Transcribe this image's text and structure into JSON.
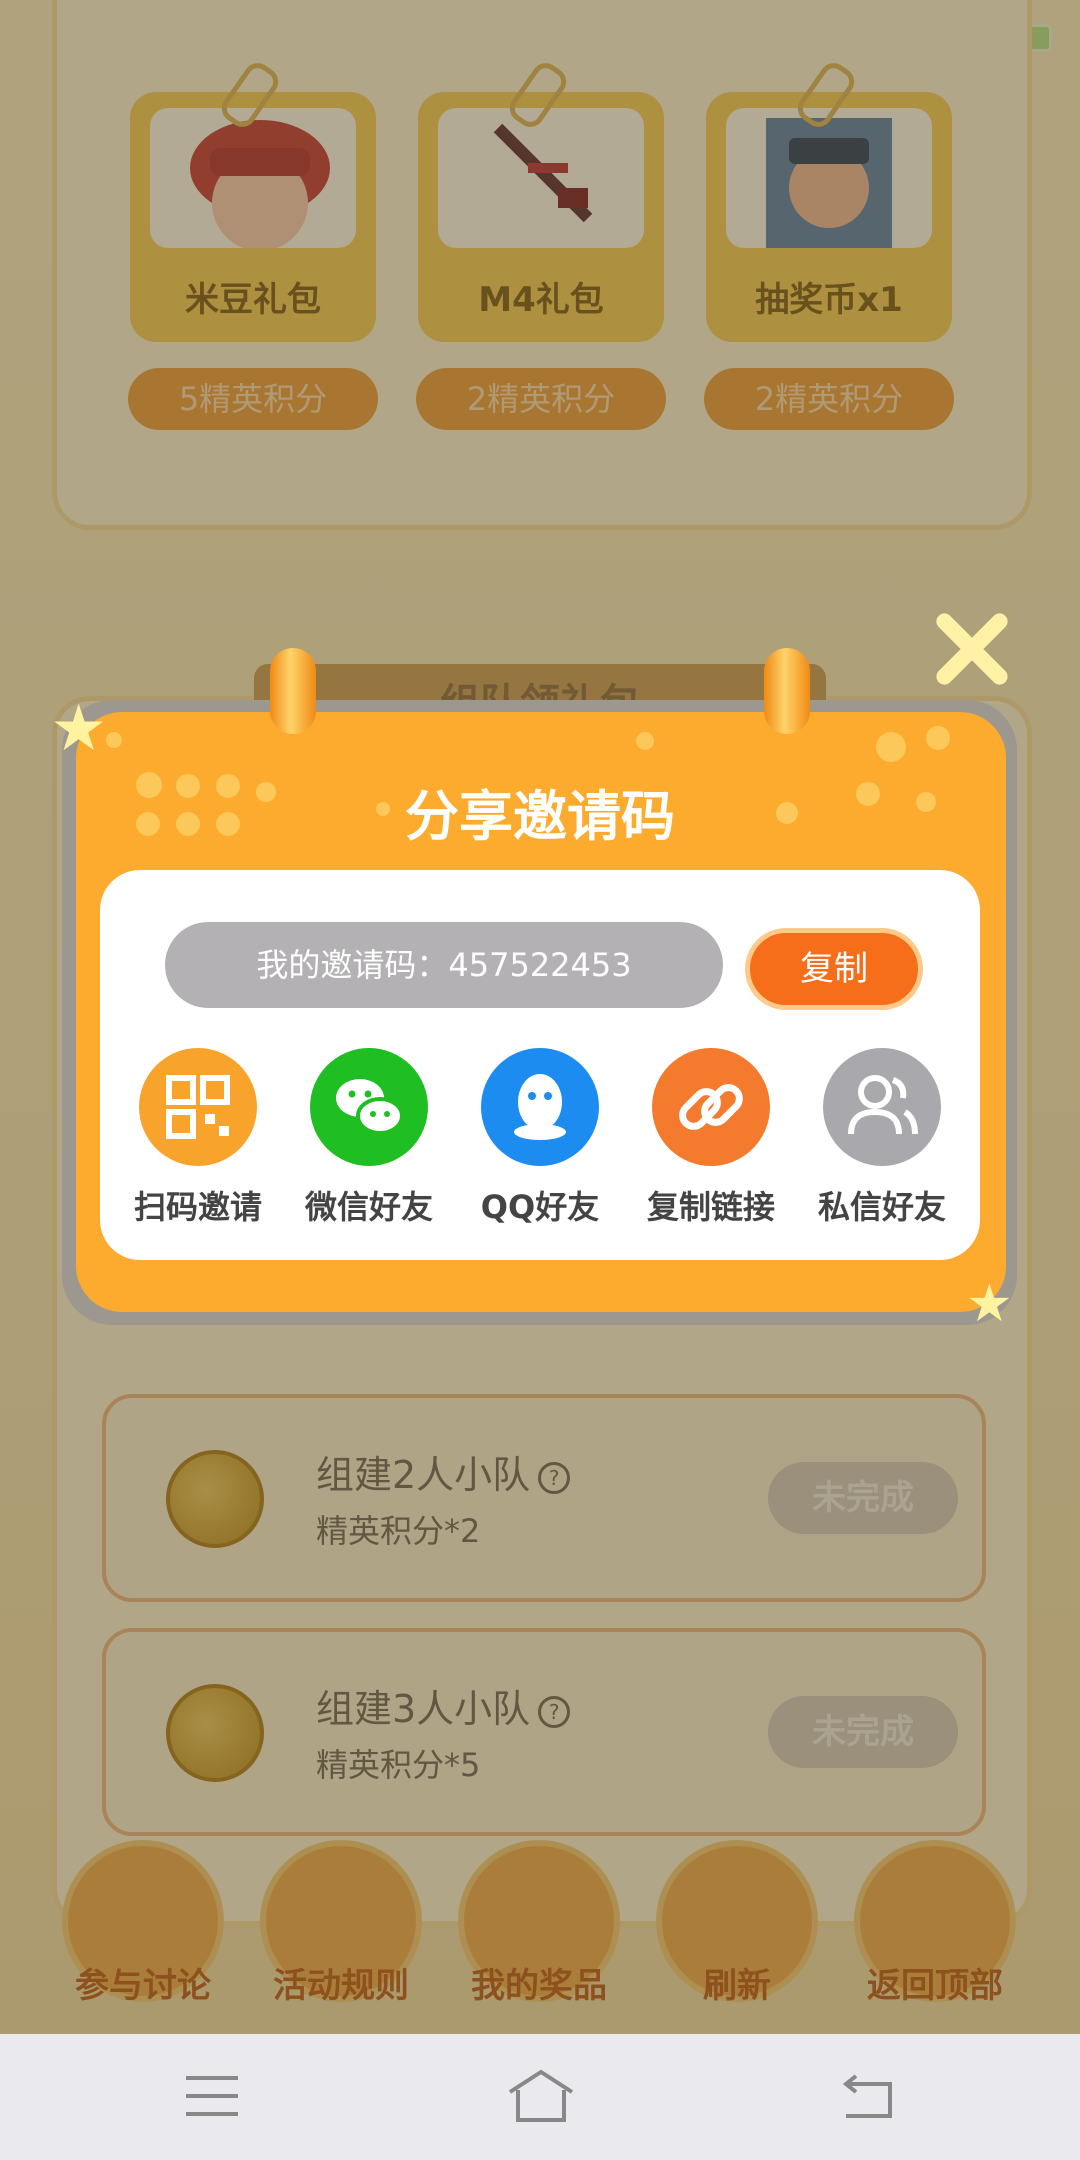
{
  "rewards": [
    {
      "name": "米豆礼包",
      "cost": "5精英积分"
    },
    {
      "name": "M4礼包",
      "cost": "2精英积分"
    },
    {
      "name": "抽奖币x1",
      "cost": "2精英积分"
    }
  ],
  "section_title": "组队领礼包",
  "tasks": [
    {
      "title": "组建2人小队",
      "reward": "精英积分*2",
      "status": "未完成"
    },
    {
      "title": "组建3人小队",
      "reward": "精英积分*5",
      "status": "未完成"
    }
  ],
  "bottom_nav": [
    {
      "label": "参与讨论"
    },
    {
      "label": "活动规则"
    },
    {
      "label": "我的奖品"
    },
    {
      "label": "刷新"
    },
    {
      "label": "返回顶部"
    }
  ],
  "modal": {
    "title": "分享邀请码",
    "invite_code_text": "我的邀请码：457522453",
    "copy_label": "复制",
    "share_options": [
      {
        "label": "扫码邀请",
        "icon": "qr-code-icon",
        "color": "#f8a42c"
      },
      {
        "label": "微信好友",
        "icon": "wechat-icon",
        "color": "#1fbe22"
      },
      {
        "label": "QQ好友",
        "icon": "qq-icon",
        "color": "#1c8cf0"
      },
      {
        "label": "复制链接",
        "icon": "link-icon",
        "color": "#f47a2e"
      },
      {
        "label": "私信好友",
        "icon": "users-icon",
        "color": "#a9a9ad"
      }
    ]
  },
  "colors": {
    "modal_orange": "#fcab2e",
    "copy_button": "#f66e1a",
    "overlay": "rgba(80,70,50,0.42)"
  }
}
